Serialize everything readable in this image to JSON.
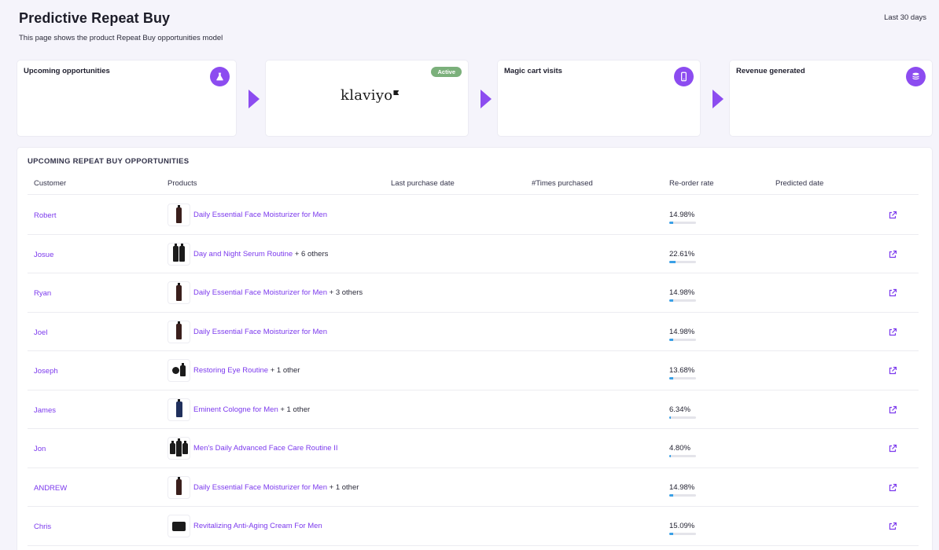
{
  "header": {
    "title": "Predictive Repeat Buy",
    "subtitle": "This page shows the product Repeat Buy opportunities model",
    "date_range": "Last 30 days"
  },
  "flow": {
    "cards": [
      {
        "title": "Upcoming opportunities",
        "icon": "flask-icon"
      },
      {
        "logo": "klaviyo",
        "badge": "Active"
      },
      {
        "title": "Magic cart visits",
        "icon": "phone-icon"
      },
      {
        "title": "Revenue generated",
        "icon": "coins-icon"
      }
    ]
  },
  "table": {
    "section_title": "UPCOMING REPEAT BUY OPPORTUNITIES",
    "columns": [
      "Customer",
      "Products",
      "Last purchase date",
      "#Times purchased",
      "Re-order rate",
      "Predicted date"
    ],
    "rows": [
      {
        "customer": "Robert",
        "thumb": "bottle",
        "product": "Daily Essential Face Moisturizer for Men",
        "extra": "",
        "rate": "14.98%",
        "rate_value": 14.98
      },
      {
        "customer": "Josue",
        "thumb": "serum-pair",
        "product": "Day and Night Serum Routine",
        "extra": "+ 6 others",
        "rate": "22.61%",
        "rate_value": 22.61
      },
      {
        "customer": "Ryan",
        "thumb": "bottle",
        "product": "Daily Essential Face Moisturizer for Men",
        "extra": "+ 3 others",
        "rate": "14.98%",
        "rate_value": 14.98
      },
      {
        "customer": "Joel",
        "thumb": "bottle",
        "product": "Daily Essential Face Moisturizer for Men",
        "extra": "",
        "rate": "14.98%",
        "rate_value": 14.98
      },
      {
        "customer": "Joseph",
        "thumb": "eye-kit",
        "product": "Restoring Eye Routine",
        "extra": "+ 1 other",
        "rate": "13.68%",
        "rate_value": 13.68
      },
      {
        "customer": "James",
        "thumb": "cologne",
        "product": "Eminent Cologne for Men",
        "extra": "+ 1 other",
        "rate": "6.34%",
        "rate_value": 6.34
      },
      {
        "customer": "Jon",
        "thumb": "serum-trio",
        "product": "Men's Daily Advanced Face Care Routine II",
        "extra": "",
        "rate": "4.80%",
        "rate_value": 4.8
      },
      {
        "customer": "ANDREW",
        "thumb": "bottle",
        "product": "Daily Essential Face Moisturizer for Men",
        "extra": "+ 1 other",
        "rate": "14.98%",
        "rate_value": 14.98
      },
      {
        "customer": "Chris",
        "thumb": "jar",
        "product": "Revitalizing Anti-Aging Cream For Men",
        "extra": "",
        "rate": "15.09%",
        "rate_value": 15.09
      }
    ]
  },
  "colors": {
    "accent": "#8c4cf0",
    "link": "#7c3aed",
    "active_badge": "#7bb07b",
    "rate_bar": "#3aa0e6"
  }
}
